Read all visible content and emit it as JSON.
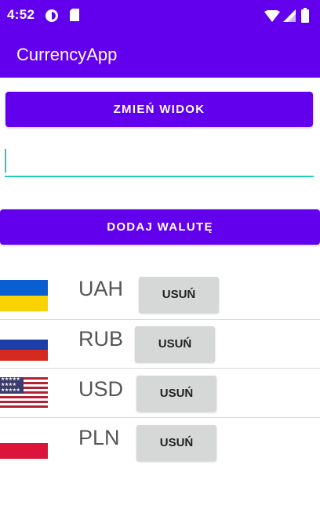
{
  "status_bar": {
    "time": "4:52"
  },
  "app_bar": {
    "title": "CurrencyApp"
  },
  "toggle_view_button": "ZMIEŃ WIDOK",
  "currency_input": {
    "value": "",
    "placeholder": ""
  },
  "add_currency_button": "DODAJ WALUTĘ",
  "currencies": [
    {
      "code": "UAH",
      "flag": "ukraine-flag",
      "remove_label": "USUŃ"
    },
    {
      "code": "RUB",
      "flag": "russia-flag",
      "remove_label": "USUŃ"
    },
    {
      "code": "USD",
      "flag": "usa-flag",
      "remove_label": "USUŃ"
    },
    {
      "code": "PLN",
      "flag": "poland-flag",
      "remove_label": "USUŃ"
    }
  ],
  "colors": {
    "primary": "#6200ee",
    "accent": "#1fcdba",
    "remove_button": "#d6d7d7"
  }
}
